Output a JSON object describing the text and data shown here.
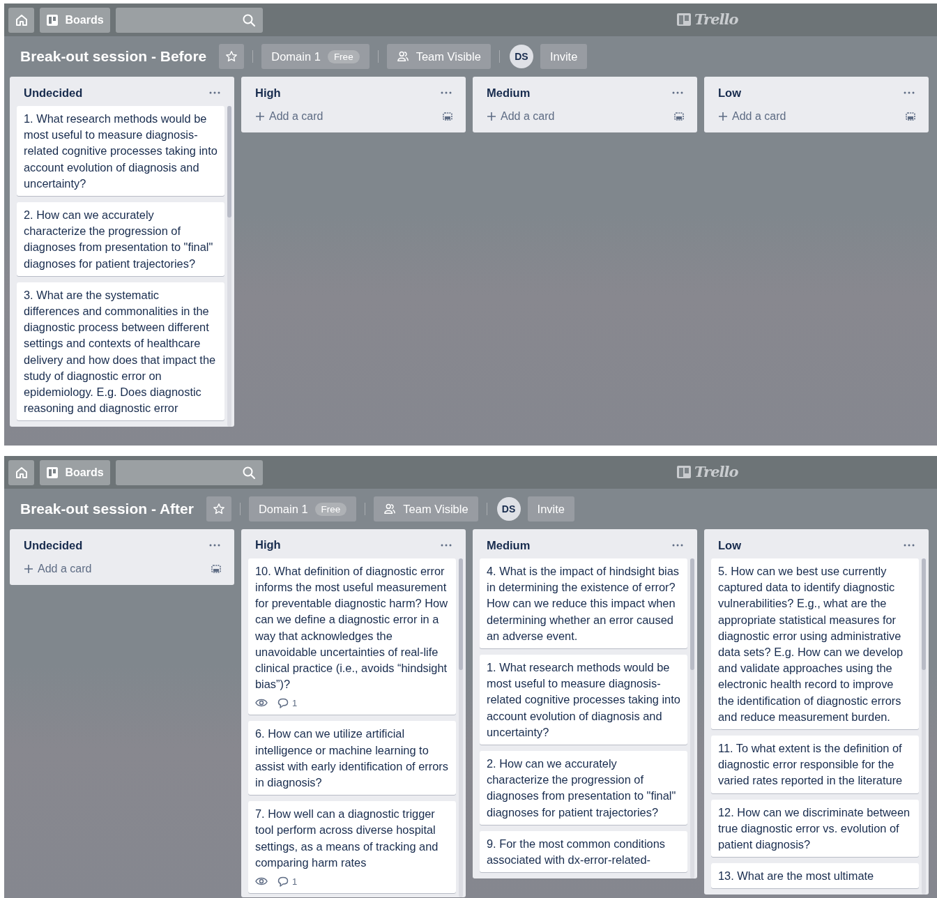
{
  "boards": [
    {
      "nav": {
        "boards_label": "Boards",
        "logo": "Trello"
      },
      "title": "Break-out session - Before",
      "starred": false,
      "workspace": "Domain 1",
      "plan": "Free",
      "visibility": "Team Visible",
      "member": "DS",
      "invite": "Invite",
      "lists": [
        {
          "name": "Undecided",
          "cards": [
            {
              "text": "1. What research methods would be most useful to measure diagnosis-related cognitive processes taking into account evolution of diagnosis and uncertainty?"
            },
            {
              "text": "2. How can we accurately characterize the progression of diagnoses from presentation to \"final\" diagnoses for patient trajectories?"
            },
            {
              "text": "3. What are the systematic differences and commonalities in the diagnostic process between different settings and contexts of healthcare delivery and how does that impact the study of diagnostic error on epidemiology. E.g. Does diagnostic reasoning and diagnostic error"
            }
          ]
        },
        {
          "name": "High",
          "add_card": "Add a card"
        },
        {
          "name": "Medium",
          "add_card": "Add a card"
        },
        {
          "name": "Low",
          "add_card": "Add a card"
        }
      ]
    },
    {
      "nav": {
        "boards_label": "Boards",
        "logo": "Trello"
      },
      "title": "Break-out session - After",
      "starred": false,
      "workspace": "Domain 1",
      "plan": "Free",
      "visibility": "Team Visible",
      "member": "DS",
      "invite": "Invite",
      "lists": [
        {
          "name": "Undecided",
          "add_card": "Add a card"
        },
        {
          "name": "High",
          "cards": [
            {
              "text": "10. What definition of diagnostic error informs the most useful measurement for preventable diagnostic harm? How can we define a diagnostic error in a way that acknowledges the unavoidable uncertainties of real-life clinical practice (i.e., avoids “hindsight bias”)?",
              "watching": true,
              "comments": "1"
            },
            {
              "text": "6. How can we utilize artificial intelligence or machine learning to assist with early identification of errors in diagnosis?"
            },
            {
              "text": "7. How well can a diagnostic trigger tool perform across diverse hospital settings, as a means of tracking and comparing harm rates",
              "watching": true,
              "comments": "1"
            }
          ]
        },
        {
          "name": "Medium",
          "cards": [
            {
              "text": "4. What is the impact of hindsight bias in determining the existence of error? How can we reduce this impact when determining whether an error caused an adverse event."
            },
            {
              "text": "1. What research methods would be most useful to measure diagnosis-related cognitive processes taking into account evolution of diagnosis and uncertainty?"
            },
            {
              "text": "2. How can we accurately characterize the progression of diagnoses from presentation to \"final\" diagnoses for patient trajectories?"
            },
            {
              "text": "9. For the most common conditions associated with dx-error-related-"
            }
          ]
        },
        {
          "name": "Low",
          "cards": [
            {
              "text": "5. How can we best use currently captured data to identify diagnostic vulnerabilities? E.g., what are the appropriate statistical measures for diagnostic error using administrative data sets? E.g. How can we develop and validate approaches using the electronic health record to improve the identification of diagnostic errors and reduce measurement burden."
            },
            {
              "text": "11. To what extent is the definition of diagnostic error responsible for the varied rates reported in the literature"
            },
            {
              "text": "12. How can we discriminate between true diagnostic error vs. evolution of patient diagnosis?"
            },
            {
              "text": "13. What are the most ultimate"
            }
          ]
        }
      ]
    }
  ]
}
